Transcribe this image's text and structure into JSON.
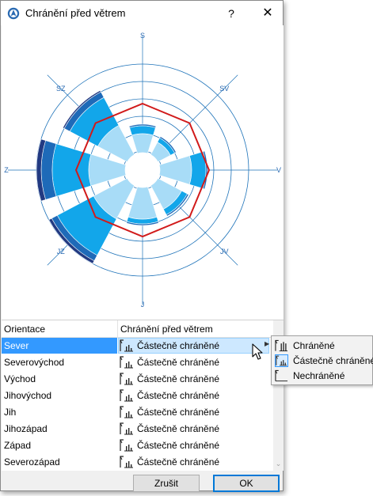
{
  "dialog": {
    "title": "Chránění před větrem",
    "help_label": "?",
    "close_label": "✕"
  },
  "compass": {
    "N": "S",
    "NE": "SV",
    "E": "V",
    "SE": "JV",
    "S": "J",
    "SW": "JZ",
    "W": "Z",
    "NW": "SZ"
  },
  "wind_rose": {
    "directions_order": [
      "S",
      "SV",
      "V",
      "JV",
      "J",
      "JZ",
      "Z",
      "SZ"
    ],
    "colors": {
      "band1": "#a8dcf7",
      "band2": "#12a6ea",
      "band3": "#1e6ab8",
      "band4": "#223a82",
      "ring": "#1e73b9",
      "outline": "#d11a1a"
    }
  },
  "table": {
    "col_orientation": "Orientace",
    "col_protection": "Chránění před větrem",
    "rows": [
      {
        "orientation": "Sever",
        "protection": "Částečně chráněné"
      },
      {
        "orientation": "Severovýchod",
        "protection": "Částečně chráněné"
      },
      {
        "orientation": "Východ",
        "protection": "Částečně chráněné"
      },
      {
        "orientation": "Jihovýchod",
        "protection": "Částečně chráněné"
      },
      {
        "orientation": "Jih",
        "protection": "Částečně chráněné"
      },
      {
        "orientation": "Jihozápad",
        "protection": "Částečně chráněné"
      },
      {
        "orientation": "Západ",
        "protection": "Částečně chráněné"
      },
      {
        "orientation": "Severozápad",
        "protection": "Částečně chráněné"
      }
    ]
  },
  "menu": {
    "items": [
      {
        "label": "Chráněné"
      },
      {
        "label": "Částečně chráněné",
        "checked": true
      },
      {
        "label": "Nechráněné"
      }
    ]
  },
  "buttons": {
    "cancel": "Zrušit",
    "ok": "OK"
  }
}
